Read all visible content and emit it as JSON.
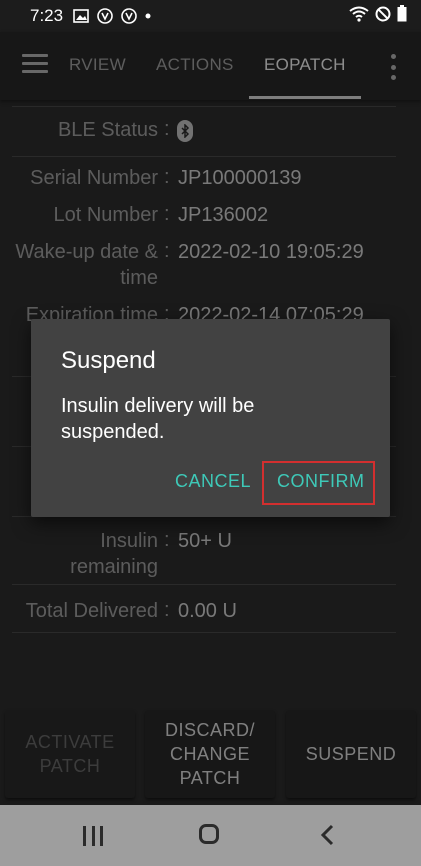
{
  "status_bar": {
    "time": "7:23"
  },
  "toolbar": {
    "tabs": [
      {
        "label": "RVIEW"
      },
      {
        "label": "ACTIONS"
      },
      {
        "label": "EOPATCH"
      }
    ]
  },
  "info": {
    "ble_status_label": "BLE Status",
    "serial_label": "Serial Number",
    "serial_value": "JP100000139",
    "lot_label": "Lot Number",
    "lot_value": "JP136002",
    "wakeup_label_line1": "Wake-up date &",
    "wakeup_label_line2": "time",
    "wakeup_value": "2022-02-10 19:05:29",
    "expiration_label": "Expiration time",
    "expiration_value": "2022-02-14 07:05:29",
    "insulin_label_line1": "Insulin",
    "insulin_label_line2": "remaining",
    "insulin_value": "50+ U",
    "total_label": "Total Delivered",
    "total_value": "0.00 U",
    "colon": ":"
  },
  "actions": {
    "activate_line1": "ACTIVATE",
    "activate_line2": "PATCH",
    "discard_line1": "DISCARD/",
    "discard_line2": "CHANGE",
    "discard_line3": "PATCH",
    "suspend": "SUSPEND"
  },
  "dialog": {
    "title": "Suspend",
    "message": "Insulin delivery will be suspended.",
    "cancel": "CANCEL",
    "confirm": "CONFIRM"
  },
  "colors": {
    "accent": "#3ec9b8",
    "highlight_box": "#d32f2f"
  },
  "nav": {
    "icons": [
      "recents-icon",
      "home-icon",
      "back-icon"
    ]
  }
}
